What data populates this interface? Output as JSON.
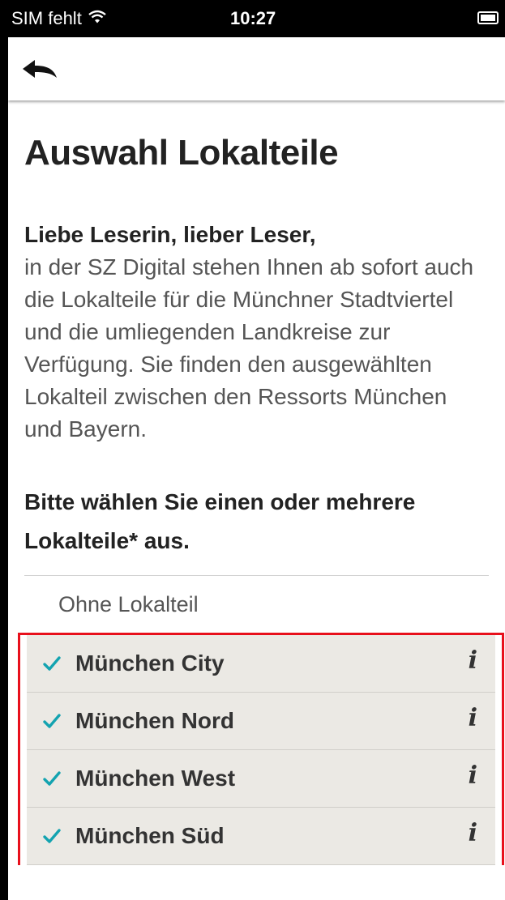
{
  "status_bar": {
    "carrier": "SIM fehlt",
    "time": "10:27"
  },
  "page": {
    "title": "Auswahl Lokalteile",
    "greeting": "Liebe Leserin, lieber Leser,",
    "intro": "in der SZ Digital stehen Ihnen ab sofort auch die Lokalteile für die Münchner Stadtviertel und die umliegenden Landkreise zur Verfügung. Sie finden den ausgewählten Lokalteil zwischen den Ressorts München und Bayern.",
    "prompt": "Bitte wählen Sie einen oder mehrere Lokalteile* aus."
  },
  "options": {
    "none_label": "Ohne Lokalteil",
    "items": [
      {
        "label": "München City",
        "checked": true,
        "info_glyph": "i"
      },
      {
        "label": "München Nord",
        "checked": true,
        "info_glyph": "i"
      },
      {
        "label": "München West",
        "checked": true,
        "info_glyph": "i"
      },
      {
        "label": "München Süd",
        "checked": true,
        "info_glyph": "i"
      }
    ]
  },
  "colors": {
    "accent_check": "#13a3b0",
    "highlight_border": "#e8101c",
    "row_background": "#ebe9e4"
  },
  "icons": {
    "back": "back-arrow-icon",
    "wifi": "wifi-icon",
    "battery": "battery-icon",
    "check": "checkmark-icon",
    "info": "info-icon"
  }
}
